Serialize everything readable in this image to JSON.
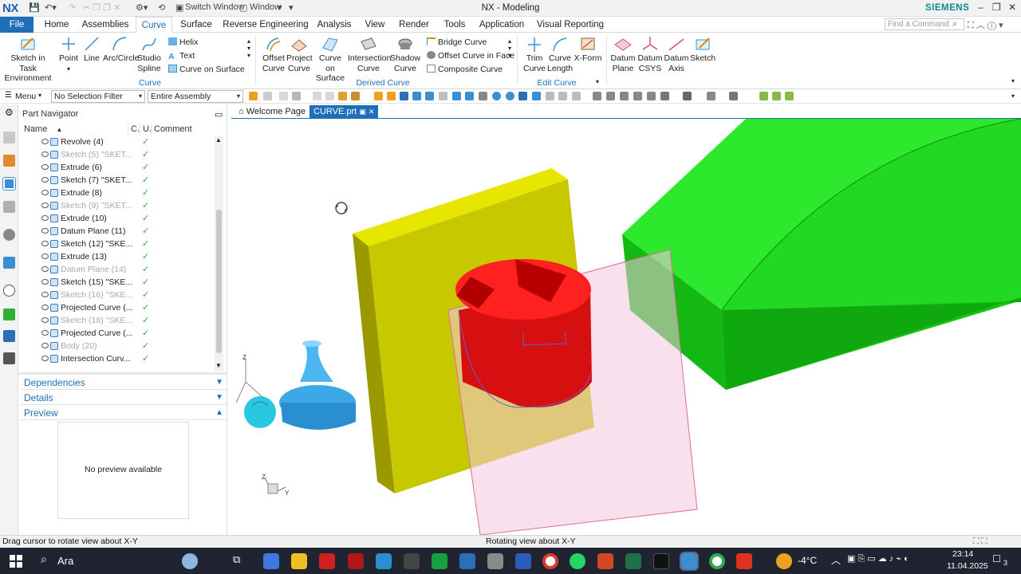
{
  "titlebar": {
    "logo": "NX",
    "switch_window": "Switch Window",
    "window_menu": "Window",
    "title": "NX - Modeling",
    "brand": "SIEMENS"
  },
  "tabs": [
    "File",
    "Home",
    "Assemblies",
    "Curve",
    "Surface",
    "Reverse Engineering",
    "Analysis",
    "View",
    "Render",
    "Tools",
    "Application",
    "Visual Reporting"
  ],
  "active_tab": "Curve",
  "find_command": {
    "placeholder": "Find a Command"
  },
  "ribbon": {
    "sketch_task": [
      "Sketch in Task",
      "Environment"
    ],
    "point": "Point",
    "line": "Line",
    "arc_circle": "Arc/Circle",
    "studio_spline": [
      "Studio",
      "Spline"
    ],
    "helix": "Helix",
    "text": "Text",
    "curve_on_surface": "Curve on Surface",
    "group_curve": "Curve",
    "offset_curve": [
      "Offset",
      "Curve"
    ],
    "project_curve": [
      "Project",
      "Curve"
    ],
    "curve_on_surface2": [
      "Curve on",
      "Surface"
    ],
    "intersection_curve": [
      "Intersection",
      "Curve"
    ],
    "shadow_curve": [
      "Shadow",
      "Curve"
    ],
    "bridge_curve": "Bridge Curve",
    "offset_curve_face": "Offset Curve in Face",
    "composite_curve": "Composite Curve",
    "group_derived": "Derived Curve",
    "trim_curve": [
      "Trim",
      "Curve"
    ],
    "curve_length": [
      "Curve",
      "Length"
    ],
    "x_form": "X-Form",
    "group_edit": "Edit Curve",
    "datum_plane": [
      "Datum",
      "Plane"
    ],
    "datum_csys": [
      "Datum",
      "CSYS"
    ],
    "datum_axis": [
      "Datum",
      "Axis"
    ],
    "sketch": "Sketch"
  },
  "toolbar": {
    "menu": "Menu",
    "selection_filter": "No Selection Filter",
    "assembly_scope": "Entire Assembly"
  },
  "navigator": {
    "title": "Part Navigator",
    "columns": [
      "Name",
      "C.",
      "U.",
      "Comment"
    ],
    "rows": [
      {
        "name": "Revolve (4)",
        "dim": false
      },
      {
        "name": "Sketch (5) \"SKET...",
        "dim": true
      },
      {
        "name": "Extrude (6)",
        "dim": false
      },
      {
        "name": "Sketch (7) \"SKET...",
        "dim": false
      },
      {
        "name": "Extrude (8)",
        "dim": false
      },
      {
        "name": "Sketch (9) \"SKET...",
        "dim": true
      },
      {
        "name": "Extrude (10)",
        "dim": false
      },
      {
        "name": "Datum Plane (11)",
        "dim": false
      },
      {
        "name": "Sketch (12) \"SKE...",
        "dim": false
      },
      {
        "name": "Extrude (13)",
        "dim": false
      },
      {
        "name": "Datum Plane (14)",
        "dim": true
      },
      {
        "name": "Sketch (15) \"SKE...",
        "dim": false
      },
      {
        "name": "Sketch (16) \"SKE...",
        "dim": true
      },
      {
        "name": "Projected Curve (...",
        "dim": false
      },
      {
        "name": "Sketch (18) \"SKE...",
        "dim": true
      },
      {
        "name": "Projected Curve (...",
        "dim": false
      },
      {
        "name": "Body (20)",
        "dim": true
      },
      {
        "name": "Intersection Curv...",
        "dim": false
      }
    ],
    "sections": {
      "dependencies": "Dependencies",
      "details": "Details",
      "preview": "Preview"
    },
    "no_preview": "No preview available"
  },
  "viewport": {
    "tabs": [
      "Welcome Page",
      "CURVE.prt"
    ],
    "active_tab": "CURVE.prt"
  },
  "status": {
    "left": "Drag cursor to rotate view about X-Y",
    "center": "Rotating view about X-Y"
  },
  "taskbar": {
    "search": "Ara",
    "weather": "-4°C",
    "time": "23:14",
    "date": "11.04.2025",
    "notifications": "3"
  },
  "colors": {
    "accent": "#1f6fb8",
    "yellow_plate": "#c8c800",
    "red_part": "#e01010",
    "green_part": "#18e018",
    "pink_plane": "#f3c8dc"
  }
}
